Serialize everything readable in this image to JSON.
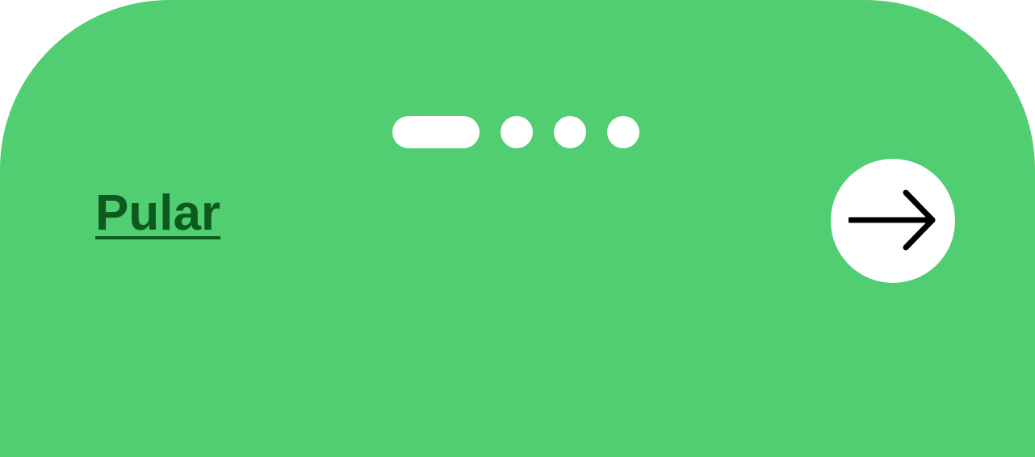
{
  "onboarding": {
    "skip_label": "Pular",
    "next_icon": "arrow-right-icon",
    "pager": {
      "total": 4,
      "active_index": 0
    }
  },
  "colors": {
    "background": "#51cd72",
    "skip_text": "#0c5a1d",
    "indicator": "#ffffff",
    "button_bg": "#ffffff",
    "icon": "#000000"
  }
}
